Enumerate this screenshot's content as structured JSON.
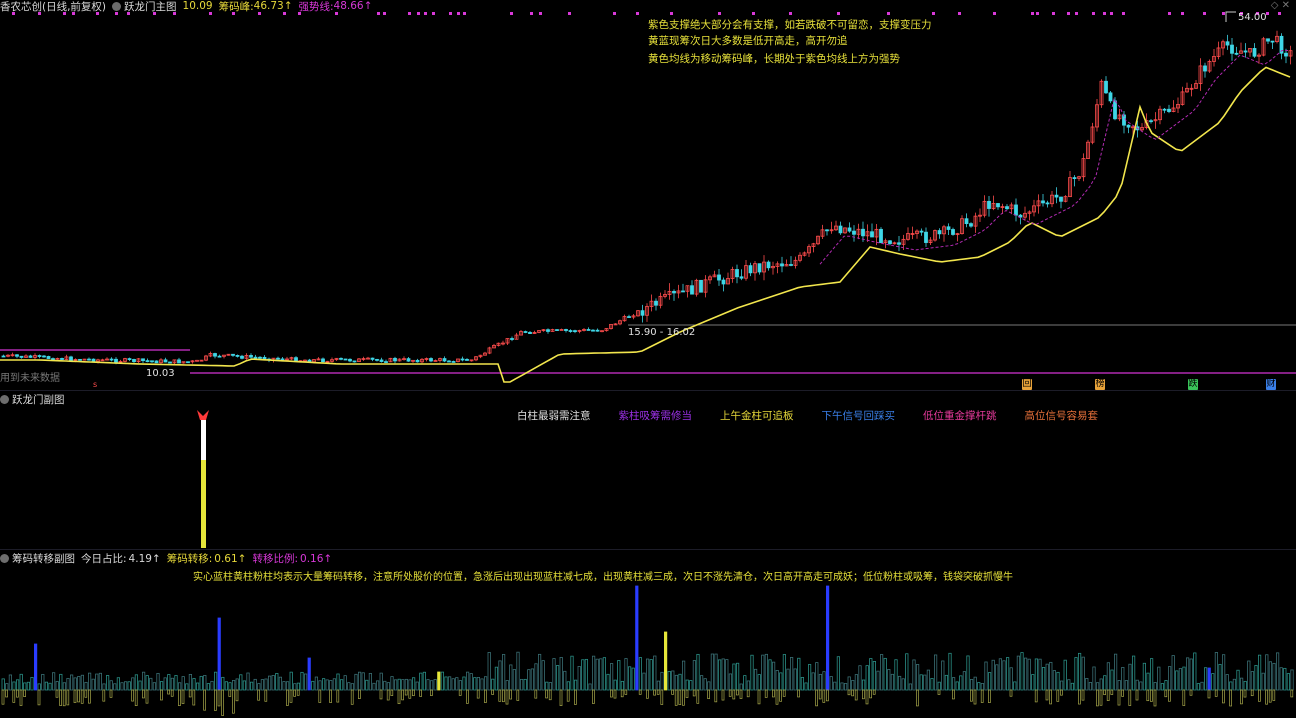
{
  "main_header": {
    "stock_name": "香农芯创(日线,前复权)",
    "indicator_name": "跃龙门主图",
    "value1": "10.09",
    "chip_peak_label": "筹码峰:",
    "chip_peak_value": "46.73↑",
    "strong_line_label": "强势线:",
    "strong_line_value": "48.66↑"
  },
  "main_notes": [
    "紫色支撑绝大部分会有支撑，如若跌破不可留恋，支撑变压力",
    "黄蓝现筹次日大多数是低开高走，高开勿追",
    "黄色均线为移动筹码峰，长期处于紫色均线上方为强势"
  ],
  "main_labels": {
    "high_price": "54.00",
    "low_price": "10.03",
    "range_label": "15.90 - 16.02",
    "future_data_note": "用到未来数据"
  },
  "event_tags": [
    {
      "text": "回",
      "color": "#e8a33a"
    },
    {
      "text": "榜",
      "color": "#e8a33a"
    },
    {
      "text": "跌",
      "color": "#3ac45a"
    },
    {
      "text": "财",
      "color": "#3a7fe8"
    }
  ],
  "sub1": {
    "title": "跃龙门副图",
    "legend": [
      {
        "text": "白柱最弱需注意",
        "color": "#e0e0e0"
      },
      {
        "text": "紫柱吸筹需修当",
        "color": "#9b30e6"
      },
      {
        "text": "上午金柱可追板",
        "color": "#e6d83a"
      },
      {
        "text": "下午信号回踩买",
        "color": "#3a7fe8"
      },
      {
        "text": "低位重金撑杆跳",
        "color": "#e63a9b"
      },
      {
        "text": "高位信号容易套",
        "color": "#e6703a"
      }
    ]
  },
  "sub2": {
    "title": "筹码转移副图",
    "today_ratio_label": "今日占比:",
    "today_ratio_value": "4.19↑",
    "chip_transfer_label": "筹码转移:",
    "chip_transfer_value": "0.61↑",
    "transfer_ratio_label": "转移比例:",
    "transfer_ratio_value": "0.16↑",
    "note": "实心蓝柱黄柱粉柱均表示大量筹码转移，注意所处股价的位置，急涨后出现出现蓝柱减七成，出现黄柱减三成，次日不涨先清仓，次日高开高走可成妖；低位粉柱或吸筹，钱袋突破抓慢牛"
  },
  "colors": {
    "up": "#ff4d4d",
    "down": "#3fd6e6",
    "ma": "#f2e64d",
    "support": "#b02ab0",
    "bg": "#000000"
  }
}
